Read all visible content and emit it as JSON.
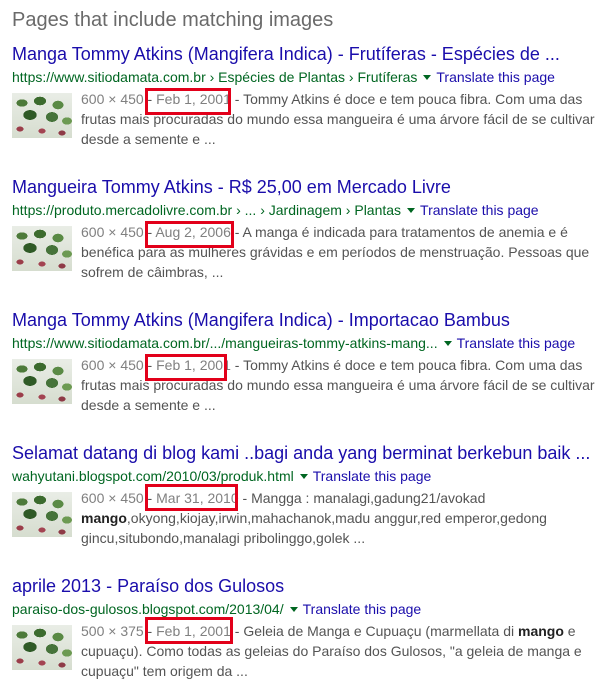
{
  "section_title": "Pages that include matching images",
  "translate_label": "Translate this page",
  "results": [
    {
      "title": "Manga Tommy Atkins (Mangifera Indica) - Frutíferas - Espécies de ...",
      "url": "https://www.sitiodamata.com.br › Espécies de Plantas › Frutíferas",
      "dims": "600 × 450",
      "date": "Feb 1, 2001",
      "snippet_before": "",
      "snippet_bold": "",
      "snippet_after": "Tommy Atkins é doce e tem pouca fibra. Com uma das frutas mais procuradas do mundo essa mangueira é uma árvore fácil de se cultivar desde a semente e ..."
    },
    {
      "title": "Mangueira Tommy Atkins - R$ 25,00 em Mercado Livre",
      "url": "https://produto.mercadolivre.com.br › ... › Jardinagem › Plantas",
      "dims": "600 × 450",
      "date": "Aug 2, 2006",
      "snippet_before": "",
      "snippet_bold": "",
      "snippet_after": "A manga é indicada para tratamentos de anemia e é benéfica para as mulheres grávidas e em períodos de menstruação. Pessoas que sofrem de câimbras, ..."
    },
    {
      "title": "Manga Tommy Atkins (Mangifera Indica) - Importacao Bambus",
      "url": "https://www.sitiodamata.com.br/.../mangueiras-tommy-atkins-mang...",
      "dims": "600 × 450",
      "date": "Feb 1, 2001",
      "snippet_before": "",
      "snippet_bold": "",
      "snippet_after": "Tommy Atkins é doce e tem pouca fibra. Com uma das frutas mais procuradas do mundo essa mangueira é uma árvore fácil de se cultivar desde a semente e ..."
    },
    {
      "title": "Selamat datang di blog kami ..bagi anda yang berminat berkebun baik ...",
      "url": "wahyutani.blogspot.com/2010/03/produk.html",
      "dims": "600 × 450",
      "date": "Mar 31, 2010",
      "snippet_before": "Mangga : manalagi,gadung21/avokad ",
      "snippet_bold": "mango",
      "snippet_after": ",okyong,kiojay,irwin,mahachanok,madu anggur,red emperor,gedong gincu,situbondo,manalagi pribolinggo,golek ..."
    },
    {
      "title": "aprile 2013 - Paraíso dos Gulosos",
      "url": "paraiso-dos-gulosos.blogspot.com/2013/04/",
      "dims": "500 × 375",
      "date": "Feb 1, 2001",
      "snippet_before": "Geleia de Manga e Cupuaçu (marmellata di ",
      "snippet_bold": "mango",
      "snippet_after": " e cupuaçu). Como todas as geleias do Paraíso dos Gulosos, \"a geleia de manga e cupuaçu\" tem origem da ..."
    }
  ]
}
